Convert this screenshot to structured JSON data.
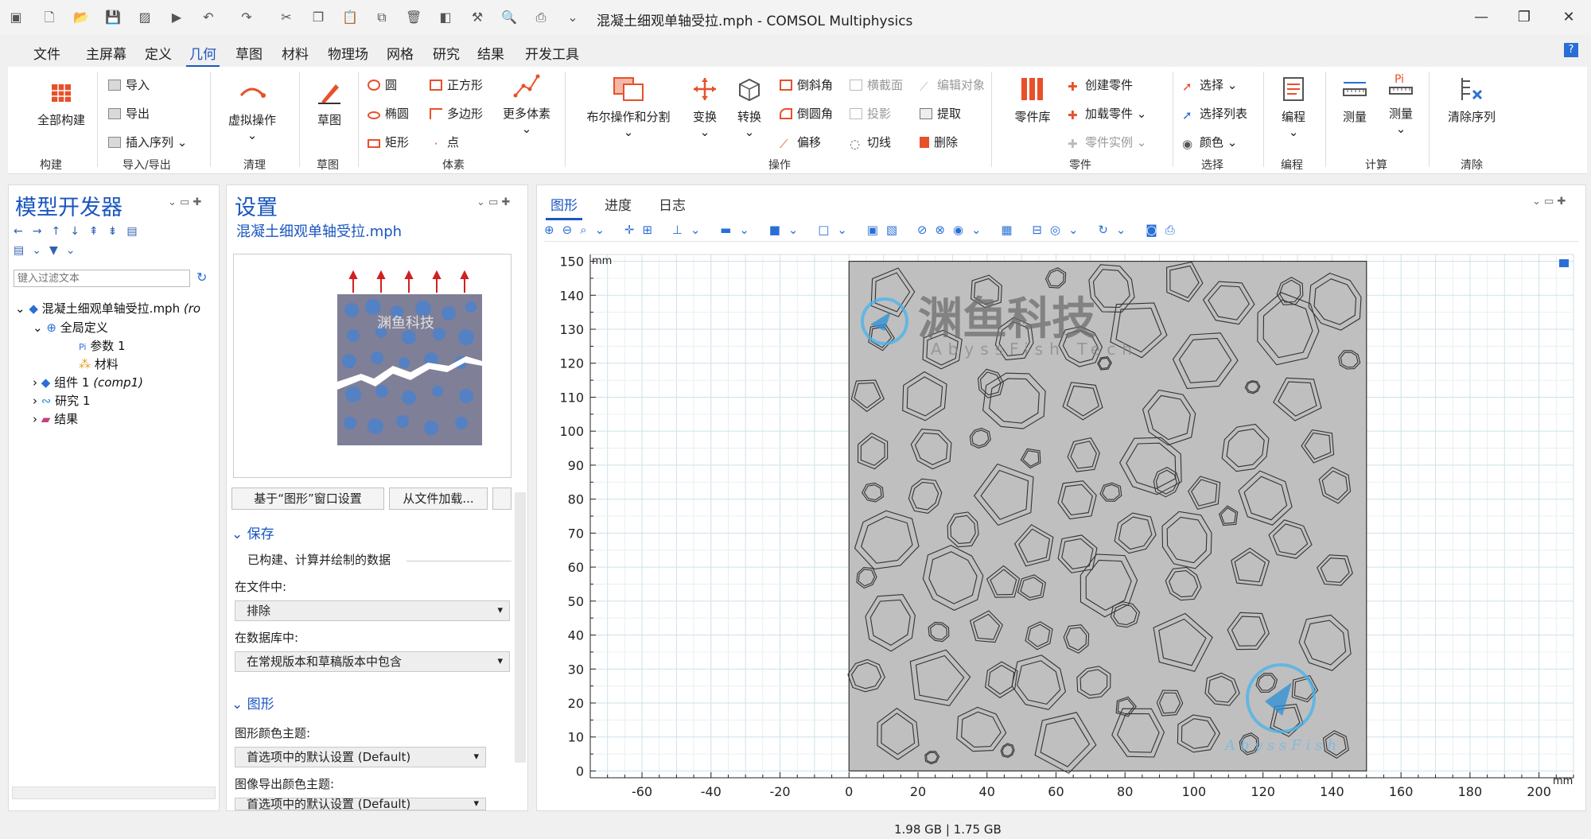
{
  "window": {
    "title": "混凝土细观单轴受拉.mph - COMSOL Multiphysics"
  },
  "menu": [
    "文件",
    "主屏幕",
    "定义",
    "几何",
    "草图",
    "材料",
    "物理场",
    "网格",
    "研究",
    "结果",
    "开发工具"
  ],
  "ribbon": {
    "build_all": "全部构建",
    "import": "导入",
    "export": "导出",
    "insert_sequence": "插入序列",
    "virtual_ops": "虚拟操作",
    "sketch": "草图",
    "circle": "圆",
    "square": "正方形",
    "ellipse": "椭圆",
    "polygon": "多边形",
    "rectangle": "矩形",
    "point": "点",
    "more_primitives": "更多体素",
    "boolean": "布尔操作和分割",
    "transform": "变换",
    "convert": "转换",
    "chamfer": "倒斜角",
    "cross_section": "横截面",
    "edit_object": "编辑对象",
    "fillet": "倒圆角",
    "projection": "投影",
    "extract": "提取",
    "offset": "偏移",
    "tangent": "切线",
    "delete": "删除",
    "part_library": "零件库",
    "create_part": "创建零件",
    "load_part": "加载零件",
    "part_instance": "零件实例",
    "select": "选择",
    "select_list": "选择列表",
    "color": "颜色",
    "programming": "编程",
    "measure1": "测量",
    "measure2": "测量",
    "clear_sequence": "清除序列",
    "groups": {
      "build": "构建",
      "import_export": "导入/导出",
      "cleanup": "清理",
      "sketch": "草图",
      "primitives": "体素",
      "operations": "操作",
      "parts": "零件",
      "selection": "选择",
      "programming": "编程",
      "compute": "计算",
      "clear": "清除"
    }
  },
  "model_builder": {
    "title": "模型开发器",
    "filter_placeholder": "键入过滤文本",
    "tree": {
      "root": "混凝土细观单轴受拉.mph",
      "root_suffix": "(ro",
      "global_defs": "全局定义",
      "params": "参数 1",
      "materials": "材料",
      "component": "组件 1",
      "component_tag": "(comp1)",
      "study": "研究 1",
      "results": "结果"
    }
  },
  "settings": {
    "title": "设置",
    "subtitle": "混凝土细观单轴受拉.mph",
    "thumbnail_watermark": "渊鱼科技",
    "btn_from_graphics": "基于“图形”窗口设置",
    "btn_load_file": "从文件加载...",
    "save_section": "保存",
    "save_desc": "已构建、计算并绘制的数据",
    "in_file_label": "在文件中:",
    "in_file_value": "排除",
    "in_db_label": "在数据库中:",
    "in_db_value": "在常规版本和草稿版本中包含",
    "graphics_section": "图形",
    "color_theme_label": "图形颜色主题:",
    "color_theme_value": "首选项中的默认设置 (Default)",
    "export_theme_label": "图像导出颜色主题:",
    "export_theme_value": "首选项中的默认设置 (Default)"
  },
  "graphics": {
    "tabs": [
      "图形",
      "进度",
      "日志"
    ],
    "unit_top": "mm",
    "unit_right": "mm",
    "watermark_cn": "渊鱼科技",
    "watermark_en": "AbyssFish Tech",
    "watermark_small": "AbyssFish"
  },
  "chart_data": {
    "type": "scatter",
    "xlim": [
      -75,
      210
    ],
    "ylim": [
      -2,
      152
    ],
    "x_ticks": [
      -60,
      -40,
      -20,
      0,
      20,
      40,
      60,
      80,
      100,
      120,
      140,
      160,
      180,
      200
    ],
    "y_ticks": [
      0,
      10,
      20,
      30,
      40,
      50,
      60,
      70,
      80,
      90,
      100,
      110,
      120,
      130,
      140,
      150
    ],
    "specimen": {
      "x": [
        0,
        150
      ],
      "y": [
        0,
        150
      ]
    },
    "grid": true,
    "aggregates": [
      {
        "x": 12,
        "y": 141,
        "r": 7
      },
      {
        "x": 40,
        "y": 141,
        "r": 5
      },
      {
        "x": 60,
        "y": 145,
        "r": 3
      },
      {
        "x": 76,
        "y": 142,
        "r": 7
      },
      {
        "x": 97,
        "y": 144,
        "r": 6
      },
      {
        "x": 110,
        "y": 138,
        "r": 7
      },
      {
        "x": 128,
        "y": 141,
        "r": 4
      },
      {
        "x": 141,
        "y": 138,
        "r": 8
      },
      {
        "x": 9,
        "y": 128,
        "r": 4
      },
      {
        "x": 27,
        "y": 124,
        "r": 6
      },
      {
        "x": 48,
        "y": 127,
        "r": 6
      },
      {
        "x": 67,
        "y": 125,
        "r": 6
      },
      {
        "x": 84,
        "y": 130,
        "r": 9
      },
      {
        "x": 103,
        "y": 121,
        "r": 9
      },
      {
        "x": 127,
        "y": 130,
        "r": 10
      },
      {
        "x": 145,
        "y": 121,
        "r": 3
      },
      {
        "x": 5,
        "y": 111,
        "r": 5
      },
      {
        "x": 22,
        "y": 110,
        "r": 7
      },
      {
        "x": 41,
        "y": 114,
        "r": 4
      },
      {
        "x": 48,
        "y": 109,
        "r": 9
      },
      {
        "x": 68,
        "y": 109,
        "r": 6
      },
      {
        "x": 74,
        "y": 120,
        "r": 2
      },
      {
        "x": 93,
        "y": 104,
        "r": 8
      },
      {
        "x": 117,
        "y": 113,
        "r": 2
      },
      {
        "x": 130,
        "y": 110,
        "r": 7
      },
      {
        "x": 7,
        "y": 94,
        "r": 5
      },
      {
        "x": 24,
        "y": 95,
        "r": 6
      },
      {
        "x": 38,
        "y": 98,
        "r": 3
      },
      {
        "x": 53,
        "y": 92,
        "r": 3
      },
      {
        "x": 68,
        "y": 93,
        "r": 5
      },
      {
        "x": 88,
        "y": 90,
        "r": 9
      },
      {
        "x": 115,
        "y": 95,
        "r": 7
      },
      {
        "x": 136,
        "y": 96,
        "r": 5
      },
      {
        "x": 141,
        "y": 84,
        "r": 5
      },
      {
        "x": 7,
        "y": 82,
        "r": 3
      },
      {
        "x": 22,
        "y": 81,
        "r": 5
      },
      {
        "x": 46,
        "y": 81,
        "r": 9
      },
      {
        "x": 66,
        "y": 80,
        "r": 6
      },
      {
        "x": 76,
        "y": 82,
        "r": 3
      },
      {
        "x": 92,
        "y": 85,
        "r": 4
      },
      {
        "x": 103,
        "y": 82,
        "r": 5
      },
      {
        "x": 121,
        "y": 80,
        "r": 8
      },
      {
        "x": 11,
        "y": 68,
        "r": 9
      },
      {
        "x": 33,
        "y": 71,
        "r": 5
      },
      {
        "x": 54,
        "y": 66,
        "r": 6
      },
      {
        "x": 66,
        "y": 64,
        "r": 6
      },
      {
        "x": 83,
        "y": 70,
        "r": 6
      },
      {
        "x": 98,
        "y": 68,
        "r": 8
      },
      {
        "x": 110,
        "y": 75,
        "r": 3
      },
      {
        "x": 128,
        "y": 68,
        "r": 6
      },
      {
        "x": 5,
        "y": 57,
        "r": 3
      },
      {
        "x": 30,
        "y": 57,
        "r": 9
      },
      {
        "x": 45,
        "y": 55,
        "r": 5
      },
      {
        "x": 53,
        "y": 54,
        "r": 4
      },
      {
        "x": 75,
        "y": 55,
        "r": 9
      },
      {
        "x": 97,
        "y": 55,
        "r": 5
      },
      {
        "x": 116,
        "y": 60,
        "r": 6
      },
      {
        "x": 141,
        "y": 59,
        "r": 5
      },
      {
        "x": 12,
        "y": 44,
        "r": 8
      },
      {
        "x": 26,
        "y": 41,
        "r": 3
      },
      {
        "x": 40,
        "y": 42,
        "r": 5
      },
      {
        "x": 55,
        "y": 40,
        "r": 4
      },
      {
        "x": 66,
        "y": 39,
        "r": 4
      },
      {
        "x": 80,
        "y": 46,
        "r": 4
      },
      {
        "x": 96,
        "y": 38,
        "r": 9
      },
      {
        "x": 116,
        "y": 41,
        "r": 6
      },
      {
        "x": 138,
        "y": 38,
        "r": 8
      },
      {
        "x": 5,
        "y": 28,
        "r": 5
      },
      {
        "x": 26,
        "y": 27,
        "r": 9
      },
      {
        "x": 44,
        "y": 27,
        "r": 5
      },
      {
        "x": 55,
        "y": 26,
        "r": 8
      },
      {
        "x": 71,
        "y": 26,
        "r": 5
      },
      {
        "x": 80,
        "y": 19,
        "r": 3
      },
      {
        "x": 93,
        "y": 20,
        "r": 4
      },
      {
        "x": 108,
        "y": 24,
        "r": 5
      },
      {
        "x": 121,
        "y": 26,
        "r": 3
      },
      {
        "x": 132,
        "y": 24,
        "r": 4
      },
      {
        "x": 14,
        "y": 11,
        "r": 7
      },
      {
        "x": 38,
        "y": 12,
        "r": 7
      },
      {
        "x": 46,
        "y": 6,
        "r": 2
      },
      {
        "x": 62,
        "y": 9,
        "r": 9
      },
      {
        "x": 84,
        "y": 11,
        "r": 8
      },
      {
        "x": 101,
        "y": 11,
        "r": 6
      },
      {
        "x": 116,
        "y": 8,
        "r": 3
      },
      {
        "x": 127,
        "y": 15,
        "r": 5
      },
      {
        "x": 141,
        "y": 8,
        "r": 4
      },
      {
        "x": 24,
        "y": 4,
        "r": 2
      }
    ]
  },
  "status": "1.98 GB | 1.75 GB"
}
